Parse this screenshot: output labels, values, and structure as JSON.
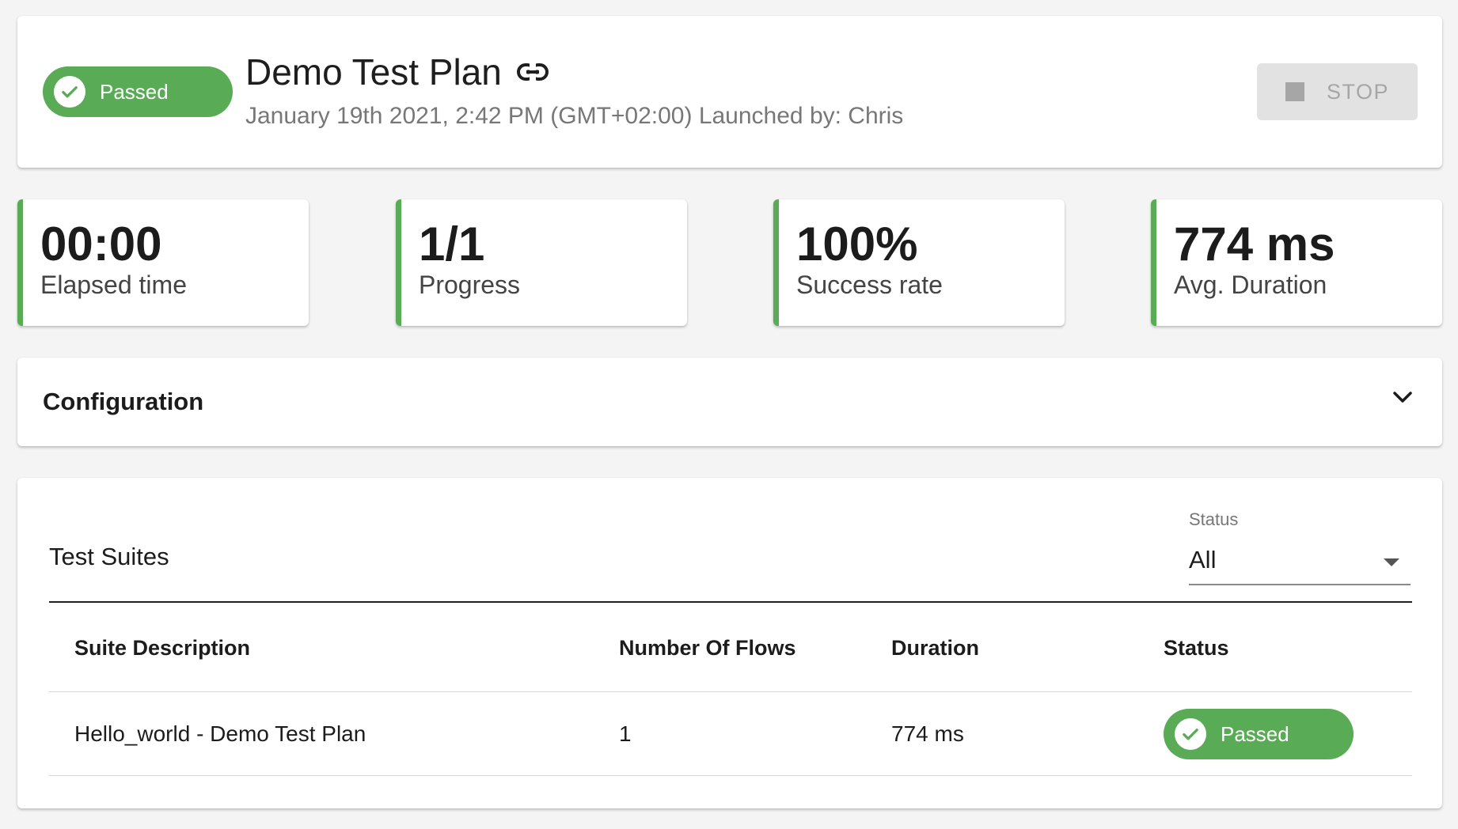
{
  "header": {
    "status_label": "Passed",
    "title": "Demo Test Plan",
    "meta": "January 19th 2021, 2:42 PM (GMT+02:00) Launched by: Chris",
    "stop_label": "STOP",
    "link_icon": "link-icon",
    "status_icon": "check-circle-icon",
    "stop_icon": "stop-square-icon"
  },
  "stats": [
    {
      "value": "00:00",
      "label": "Elapsed time"
    },
    {
      "value": "1/1",
      "label": "Progress"
    },
    {
      "value": "100%",
      "label": "Success rate"
    },
    {
      "value": "774 ms",
      "label": "Avg. Duration"
    }
  ],
  "configuration": {
    "title": "Configuration",
    "expand_icon": "chevron-down-icon"
  },
  "suites": {
    "title": "Test Suites",
    "filter": {
      "label": "Status",
      "value": "All"
    },
    "columns": [
      "Suite Description",
      "Number Of Flows",
      "Duration",
      "Status"
    ],
    "rows": [
      {
        "description": "Hello_world - Demo Test Plan",
        "flows": "1",
        "duration": "774 ms",
        "status": "Passed"
      }
    ]
  },
  "colors": {
    "accent_green": "#5aab55",
    "background": "#f4f4f4",
    "disabled_button": "#e2e2e2"
  }
}
